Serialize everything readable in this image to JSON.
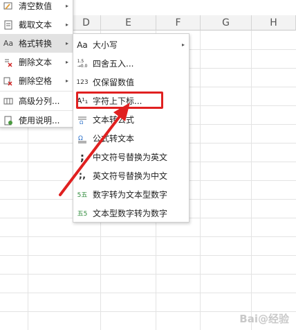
{
  "columns": [
    "D",
    "E",
    "F",
    "G",
    "H"
  ],
  "left_menu": [
    {
      "icon": "clear-values-icon",
      "label": "清空数值",
      "has_submenu": true
    },
    {
      "icon": "extract-text-icon",
      "label": "截取文本",
      "has_submenu": true
    },
    {
      "icon": "format-convert-icon",
      "label": "格式转换",
      "has_submenu": true,
      "active": true
    },
    {
      "icon": "delete-text-icon",
      "label": "删除文本",
      "has_submenu": true
    },
    {
      "icon": "delete-space-icon",
      "label": "删除空格",
      "has_submenu": true
    },
    {
      "icon": "advanced-split-icon",
      "label": "高级分列...",
      "has_submenu": false
    },
    {
      "icon": "help-doc-icon",
      "label": "使用说明...",
      "has_submenu": false
    }
  ],
  "sub_menu": [
    {
      "icon": "Aa",
      "label": "大小写",
      "has_submenu": true
    },
    {
      "icon": "1.5→0.0",
      "label": "四舍五入..."
    },
    {
      "icon": "123",
      "label": "仅保留数值"
    },
    {
      "icon": "A¹₁",
      "label": "字符上下标...",
      "highlighted": true
    },
    {
      "icon": "text-to-formula-icon",
      "label": "文本转公式"
    },
    {
      "icon": "formula-to-text-icon",
      "label": "公式转文本"
    },
    {
      "icon": ";",
      "label": "中文符号替换为英文"
    },
    {
      "icon": ";,",
      "label": "英文符号替换为中文"
    },
    {
      "icon": "5五",
      "label": "数字转为文本型数字"
    },
    {
      "icon": "五5",
      "label": "文本型数字转为数字"
    }
  ],
  "watermark": "Bai@经验",
  "colors": {
    "highlight": "#e02020",
    "menu_active": "#e2e2e2"
  }
}
